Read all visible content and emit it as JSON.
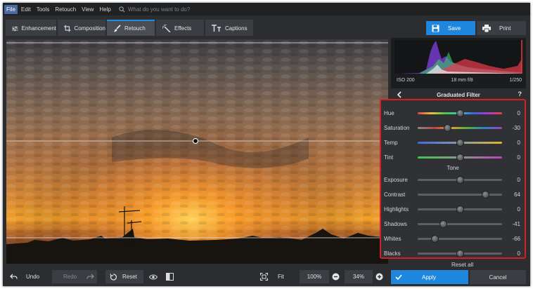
{
  "menu": {
    "items": [
      "File",
      "Edit",
      "Tools",
      "Retouch",
      "View",
      "Help"
    ],
    "active": "File",
    "search_placeholder": "What do you want to do?"
  },
  "tabs": [
    {
      "label": "Enhancement",
      "icon": "sliders-icon"
    },
    {
      "label": "Composition",
      "icon": "crop-icon"
    },
    {
      "label": "Retouch",
      "icon": "brush-icon",
      "active": true
    },
    {
      "label": "Effects",
      "icon": "magic-wand-icon"
    },
    {
      "label": "Captions",
      "icon": "text-icon"
    }
  ],
  "toolbar": {
    "save_label": "Save",
    "print_label": "Print"
  },
  "histogram": {
    "iso": "ISO 200",
    "lens": "18 mm f/8",
    "shutter": "1/250"
  },
  "panel": {
    "title": "Graduated Filter",
    "help": "?",
    "tone_label": "Tone",
    "reset_all": "Reset all"
  },
  "sliders": [
    {
      "label": "Hue",
      "value": "0",
      "pos": 0.5,
      "track": "hue"
    },
    {
      "label": "Saturation",
      "value": "-30",
      "pos": 0.35,
      "track": "saturation"
    },
    {
      "label": "Temp",
      "value": "0",
      "pos": 0.5,
      "track": "temp"
    },
    {
      "label": "Tint",
      "value": "0",
      "pos": 0.5,
      "track": "tint"
    },
    {
      "label": "Exposure",
      "value": "0",
      "pos": 0.5,
      "track": "gray"
    },
    {
      "label": "Contrast",
      "value": "64",
      "pos": 0.8,
      "track": "gray"
    },
    {
      "label": "Highlights",
      "value": "0",
      "pos": 0.5,
      "track": "gray"
    },
    {
      "label": "Shadows",
      "value": "-41",
      "pos": 0.3,
      "track": "gray"
    },
    {
      "label": "Whites",
      "value": "-66",
      "pos": 0.2,
      "track": "gray"
    },
    {
      "label": "Blacks",
      "value": "0",
      "pos": 0.5,
      "track": "gray"
    }
  ],
  "bottom": {
    "undo": "Undo",
    "redo": "Redo",
    "reset": "Reset",
    "fit": "Fit",
    "zoom_100": "100%",
    "zoom_current": "34%",
    "apply": "Apply",
    "cancel": "Cancel"
  },
  "colors": {
    "accent": "#1e86dc",
    "highlight_border": "#d32024",
    "background": "#2b2d30"
  }
}
